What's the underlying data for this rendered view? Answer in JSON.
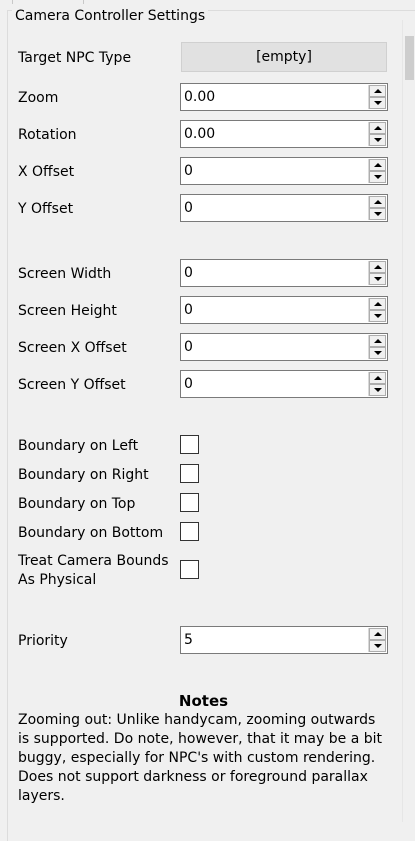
{
  "panel": {
    "title": "Camera Controller Settings"
  },
  "fields": {
    "target_npc": {
      "label": "Target NPC Type",
      "value": "[empty]"
    },
    "zoom": {
      "label": "Zoom",
      "value": "0.00"
    },
    "rotation": {
      "label": "Rotation",
      "value": "0.00"
    },
    "x_offset": {
      "label": "X Offset",
      "value": "0"
    },
    "y_offset": {
      "label": "Y Offset",
      "value": "0"
    },
    "screen_width": {
      "label": "Screen Width",
      "value": "0"
    },
    "screen_height": {
      "label": "Screen Height",
      "value": "0"
    },
    "screen_x_offset": {
      "label": "Screen X Offset",
      "value": "0"
    },
    "screen_y_offset": {
      "label": "Screen Y Offset",
      "value": "0"
    },
    "boundary_left": {
      "label": "Boundary on Left",
      "checked": false
    },
    "boundary_right": {
      "label": "Boundary on Right",
      "checked": false
    },
    "boundary_top": {
      "label": "Boundary on Top",
      "checked": false
    },
    "boundary_bottom": {
      "label": "Boundary on Bottom",
      "checked": false
    },
    "physical": {
      "label_line1": "Treat Camera Bounds",
      "label_line2": "As Physical",
      "checked": false
    },
    "priority": {
      "label": "Priority",
      "value": "5"
    }
  },
  "notes": {
    "title": "Notes",
    "lines": [
      "Zooming out: Unlike handycam, zooming outwards",
      "is supported. Do note, however, that it may be a bit",
      "buggy, especially for NPC's with custom rendering.",
      "Does not support darkness or foreground parallax",
      "layers."
    ]
  }
}
